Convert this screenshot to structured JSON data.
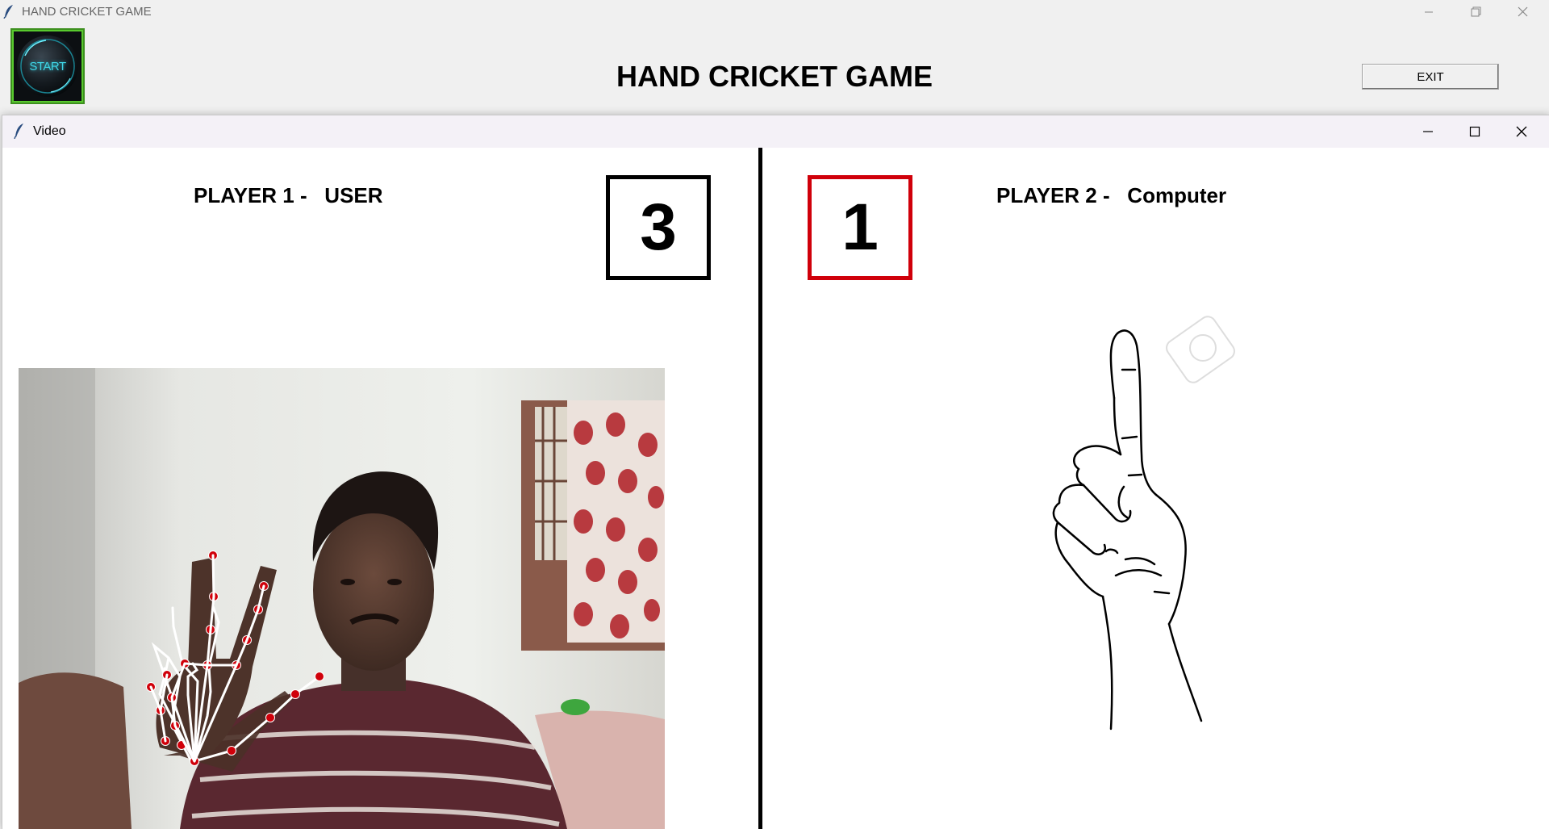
{
  "window": {
    "title": "HAND CRICKET GAME",
    "controls": [
      "minimize-icon",
      "restore-icon",
      "close-icon"
    ]
  },
  "app": {
    "start_label": "START",
    "heading": "HAND CRICKET GAME",
    "exit_label": "EXIT"
  },
  "video_window": {
    "title": "Video",
    "controls": [
      "minimize-icon",
      "maximize-icon",
      "close-icon"
    ]
  },
  "player1": {
    "label": "PLAYER 1 -   USER",
    "score": "3",
    "box_color": "#000000"
  },
  "player2": {
    "label": "PLAYER 2 -   Computer",
    "score": "1",
    "box_color": "#d0000a"
  },
  "colors": {
    "start_border": "#58c92e",
    "start_text": "#3fd6e6",
    "landmark_dot": "#d0000a",
    "skeleton_line": "#ffffff"
  }
}
